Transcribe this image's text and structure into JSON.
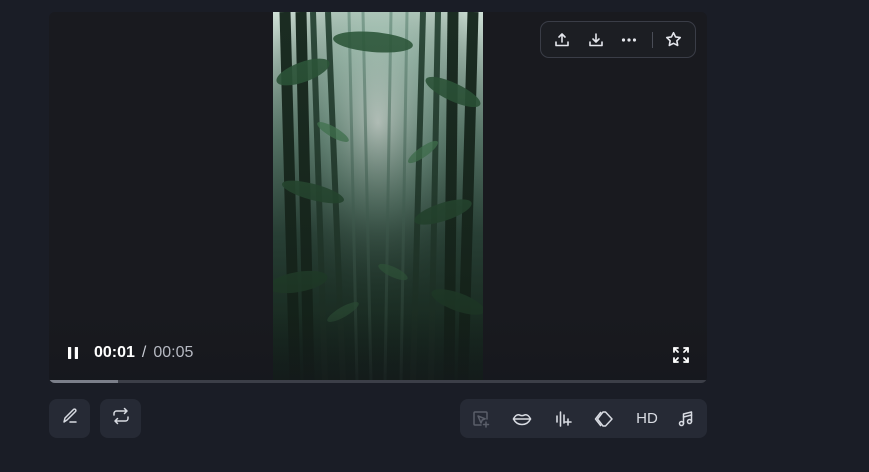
{
  "player": {
    "video_description_icon": "bamboo-forest-frame",
    "time_current": "00:01",
    "time_separator": "/",
    "time_total": "00:05",
    "progress_fraction": 0.105,
    "state": "playing"
  },
  "top_actions": {
    "items": [
      "share-icon",
      "download-icon",
      "more-icon",
      "star-icon"
    ]
  },
  "bottom_left": {
    "items": [
      "edit-icon",
      "repeat-icon"
    ]
  },
  "toolbar": {
    "hd_label": "HD",
    "items": [
      "add-frame-icon",
      "lip-sync-icon",
      "audio-enhance-icon",
      "extend-icon",
      "hd-button",
      "music-icon"
    ]
  },
  "colors": {
    "background": "#1a1d26",
    "player_bg": "#191a1f",
    "button_bg": "#262a35",
    "icon": "#d8dbe2",
    "icon_disabled": "#5a5e69"
  }
}
